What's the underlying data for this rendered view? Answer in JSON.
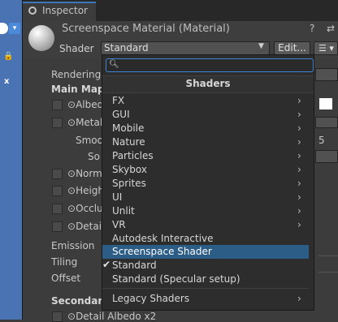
{
  "tab": {
    "title": "Inspector"
  },
  "header": {
    "title": "Screenspace Material (Material)",
    "shader_label": "Shader",
    "shader_value": "Standard",
    "edit_label": "Edit...",
    "list_label": "☰ ▾"
  },
  "properties": {
    "rendering": "Rendering",
    "main_maps": "Main Maps",
    "albedo": "Albedo",
    "metallic": "Metal",
    "smoothness": "Smoo",
    "source": "So",
    "normal": "Norm",
    "height": "Heigh",
    "occlusion": "Occlu",
    "detail": "Detai",
    "emission": "Emission",
    "tiling": "Tiling",
    "offset": "Offset",
    "secondary": "Secondary",
    "detail_albedo": "Detail Albedo x2",
    "smooth_value": "5"
  },
  "dropdown": {
    "search_placeholder": "",
    "title": "Shaders",
    "items": [
      {
        "label": "FX",
        "submenu": true
      },
      {
        "label": "GUI",
        "submenu": true
      },
      {
        "label": "Mobile",
        "submenu": true
      },
      {
        "label": "Nature",
        "submenu": true
      },
      {
        "label": "Particles",
        "submenu": true
      },
      {
        "label": "Skybox",
        "submenu": true
      },
      {
        "label": "Sprites",
        "submenu": true
      },
      {
        "label": "UI",
        "submenu": true
      },
      {
        "label": "Unlit",
        "submenu": true
      },
      {
        "label": "VR",
        "submenu": true
      },
      {
        "label": "Autodesk Interactive",
        "submenu": false
      },
      {
        "label": "Screenspace Shader",
        "submenu": false,
        "highlighted": true
      },
      {
        "label": "Standard",
        "submenu": false,
        "checked": true
      },
      {
        "label": "Standard (Specular setup)",
        "submenu": false
      }
    ],
    "legacy": {
      "label": "Legacy Shaders",
      "submenu": true
    }
  },
  "colors": {
    "accent": "#2c5d87",
    "focus": "#3f85d6",
    "panel": "#3c3c3c"
  }
}
